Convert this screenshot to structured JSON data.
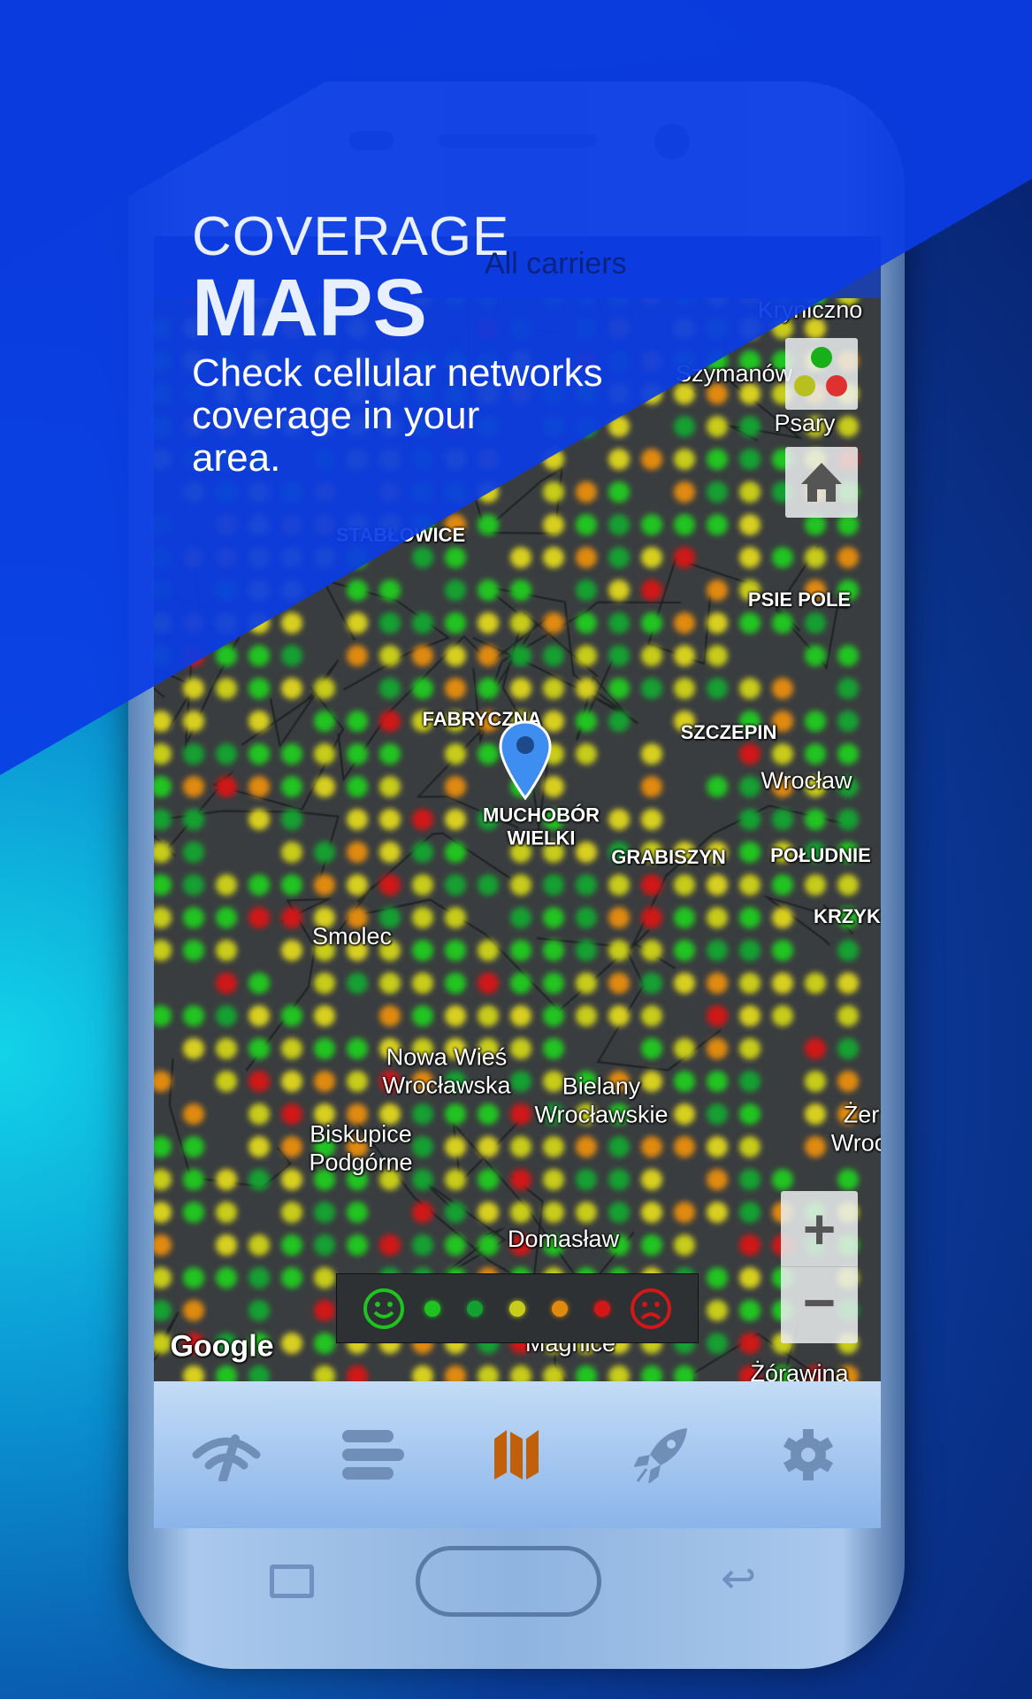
{
  "hero": {
    "line1": "COVERAGE",
    "line2": "MAPS",
    "desc": [
      "Check cellular networks",
      "coverage in your",
      "area."
    ]
  },
  "map": {
    "carrier_selector": "All carriers",
    "attribution": "Google",
    "labels": [
      {
        "text": "Kryniczno",
        "bold": false
      },
      {
        "text": "Szymanów",
        "bold": false
      },
      {
        "text": "Psary",
        "bold": false
      },
      {
        "text": "STABŁOWICE",
        "bold": true
      },
      {
        "text": "PSIE POLE",
        "bold": true
      },
      {
        "text": "FABRYCZNA",
        "bold": true
      },
      {
        "text": "SZCZEPIN",
        "bold": true
      },
      {
        "text": "Wrocław",
        "bold": false
      },
      {
        "text": "MUCHOBÓR\nWIELKI",
        "bold": true
      },
      {
        "text": "GRABISZYN",
        "bold": true
      },
      {
        "text": "POŁUDNIE",
        "bold": true
      },
      {
        "text": "KRZYKI",
        "bold": true
      },
      {
        "text": "Smolec",
        "bold": false
      },
      {
        "text": "Nowa Wieś\nWrocławska",
        "bold": false
      },
      {
        "text": "Bielany\nWrocławskie",
        "bold": false
      },
      {
        "text": "Biskupice\nPodgórne",
        "bold": false
      },
      {
        "text": "Żer\nWrocł",
        "bold": false
      },
      {
        "text": "Domasław",
        "bold": false
      },
      {
        "text": "Magnice",
        "bold": false
      },
      {
        "text": "Żórawina",
        "bold": false
      }
    ],
    "legend_colors": [
      "#1fc21f",
      "#13a030",
      "#c8cc1a",
      "#e08a10",
      "#d01818"
    ],
    "zoom_in": "+",
    "zoom_out": "−"
  },
  "nav": {
    "items": [
      {
        "icon": "speedtest-icon"
      },
      {
        "icon": "list-icon"
      },
      {
        "icon": "map-icon",
        "active": true
      },
      {
        "icon": "rocket-icon"
      },
      {
        "icon": "gear-icon"
      }
    ],
    "active_color": "#c0600a",
    "inactive_color": "#6f8fb8"
  }
}
